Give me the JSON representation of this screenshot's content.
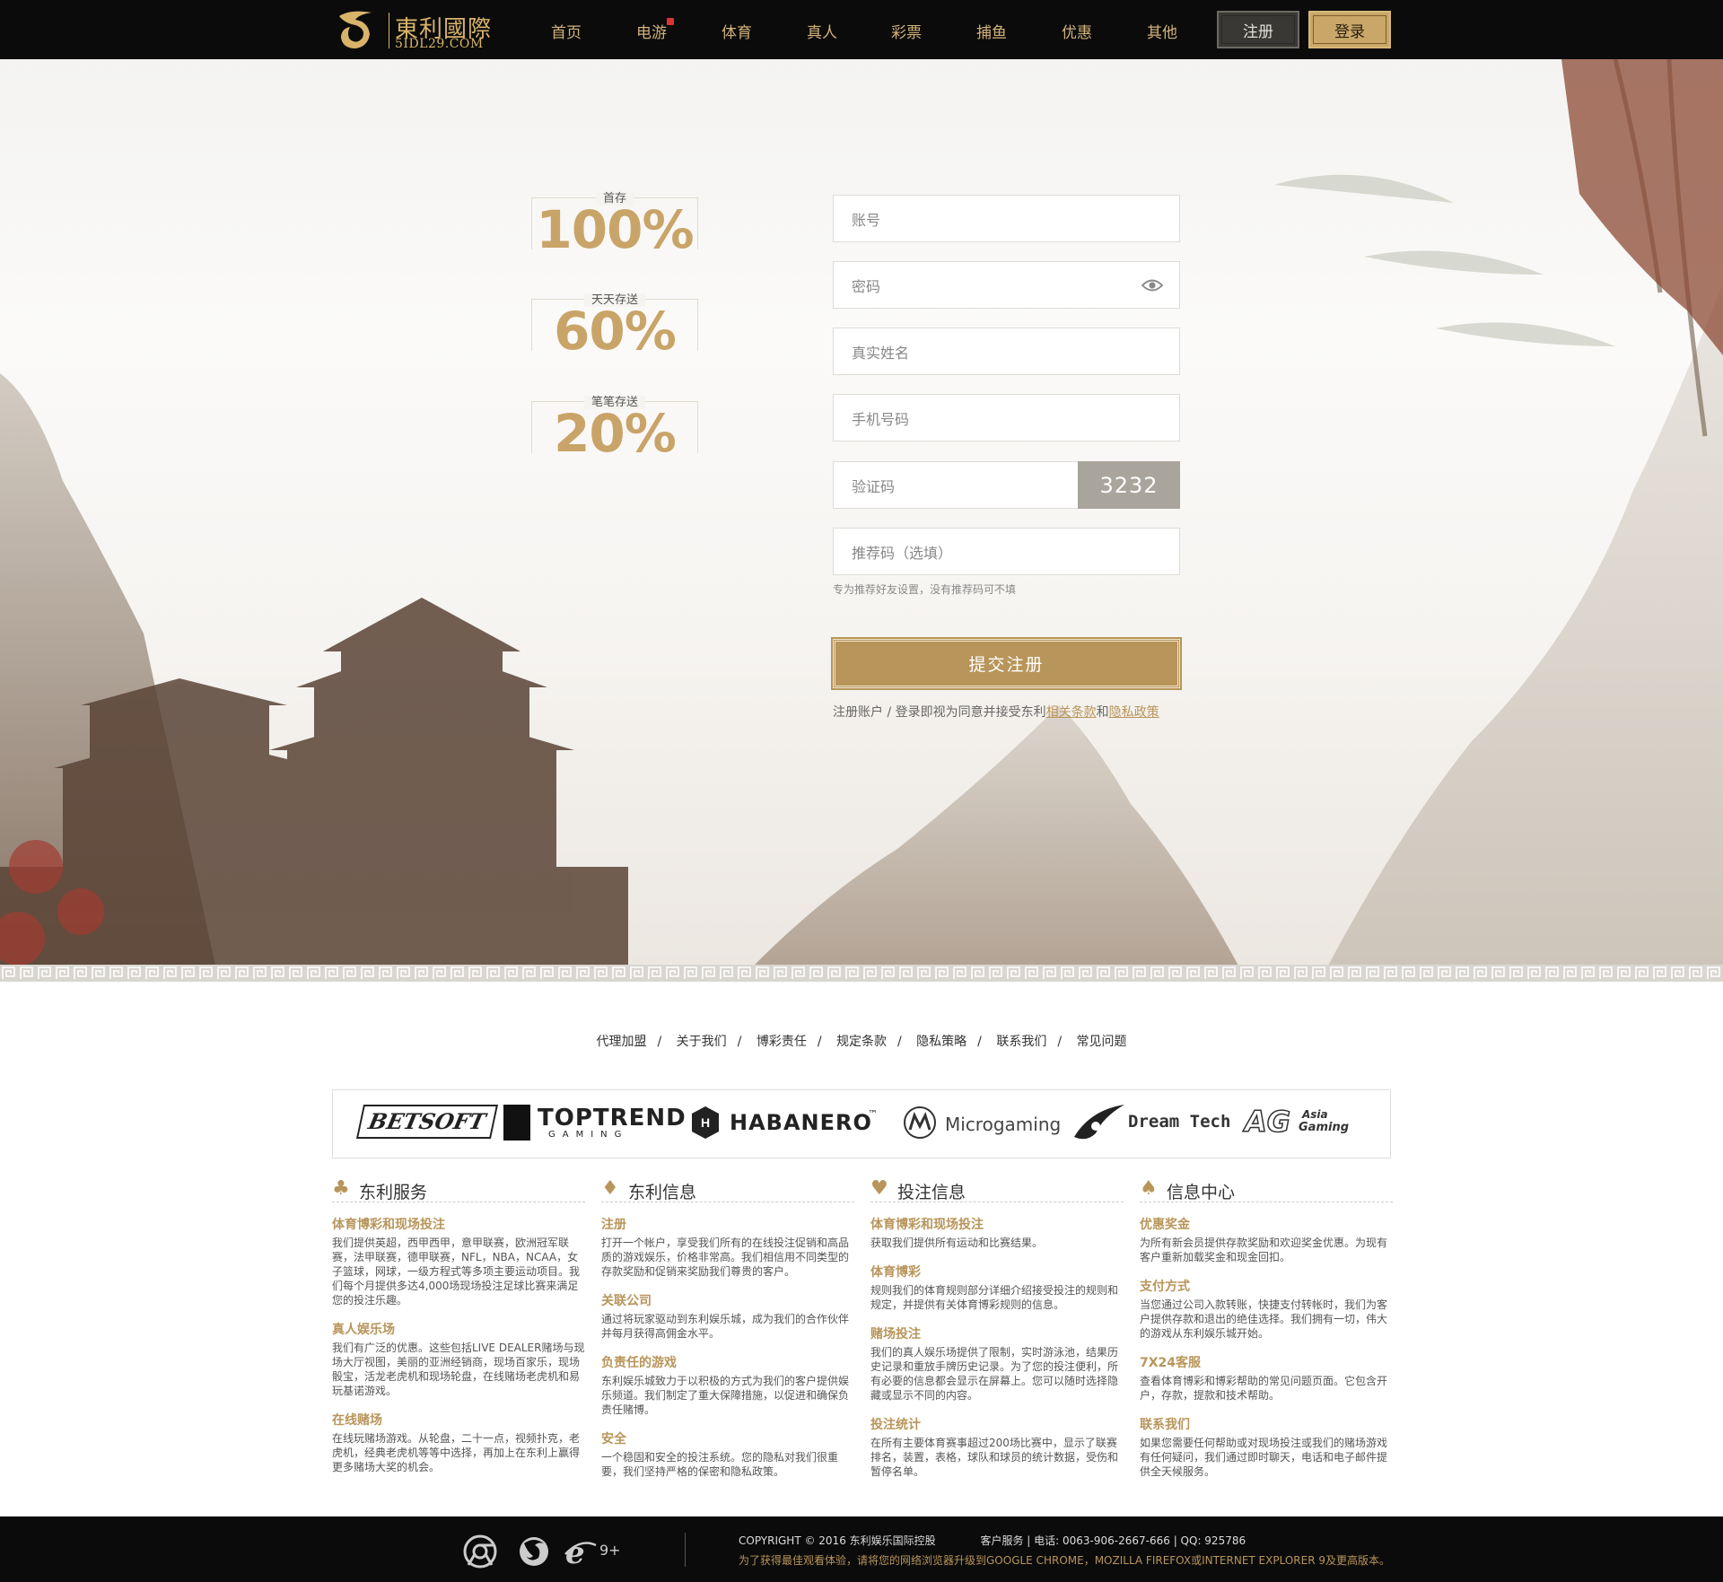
{
  "header": {
    "logo_cn": "東利國際",
    "logo_domain": "5IDL29.COM",
    "nav": [
      "首页",
      "电游",
      "体育",
      "真人",
      "彩票",
      "捕鱼",
      "优惠",
      "其他"
    ],
    "register_label": "注册",
    "login_label": "登录"
  },
  "promos": [
    {
      "label": "首存",
      "value": "100%"
    },
    {
      "label": "天天存送",
      "value": "60%"
    },
    {
      "label": "笔笔存送",
      "value": "20%"
    }
  ],
  "form": {
    "account_placeholder": "账号",
    "password_placeholder": "密码",
    "realname_placeholder": "真实姓名",
    "phone_placeholder": "手机号码",
    "captcha_placeholder": "验证码",
    "captcha_code": "3232",
    "referral_placeholder": "推荐码（选填）",
    "referral_hint": "专为推荐好友设置，没有推荐码可不填",
    "submit_label": "提交注册",
    "terms_prefix": "注册账户 / 登录即视为同意并接受东利",
    "terms_link": "相关条款",
    "terms_and": "和",
    "privacy_link": "隐私政策"
  },
  "footer_links": [
    "代理加盟",
    "关于我们",
    "博彩责任",
    "规定条款",
    "隐私策略",
    "联系我们",
    "常见问题"
  ],
  "footer_link_separator": "/",
  "providers": [
    "BETSOFT",
    "TOPTREND",
    "GAMING",
    "HABANERO",
    "™",
    "Microgaming",
    "Dream Tech",
    "Asia",
    "Gaming"
  ],
  "columns": [
    {
      "icon": "♣",
      "title": "东利服务",
      "sections": [
        {
          "title": "体育博彩和现场投注",
          "body": "我们提供英超，西甲西甲，意甲联赛，欧洲冠军联赛，法甲联赛，德甲联赛，NFL，NBA，NCAA，女子篮球，网球，一级方程式等多项主要运动项目。我们每个月提供多达4,000场现场投注足球比赛来满足您的投注乐趣。"
        },
        {
          "title": "真人娱乐场",
          "body": "我们有广泛的优惠。这些包括LIVE DEALER赌场与现场大厅视图，美丽的亚洲经销商，现场百家乐，现场骰宝，活龙老虎机和现场轮盘，在线赌场老虎机和易玩基诺游戏。"
        },
        {
          "title": "在线赌场",
          "body": "在线玩赌场游戏。从轮盘，二十一点，视频扑克，老虎机，经典老虎机等等中选择，再加上在东利上赢得更多赌场大奖的机会。"
        }
      ]
    },
    {
      "icon": "♦",
      "title": "东利信息",
      "sections": [
        {
          "title": "注册",
          "body": "打开一个帐户，享受我们所有的在线投注促销和高品质的游戏娱乐，价格非常高。我们相信用不同类型的存款奖励和促销来奖励我们尊贵的客户。"
        },
        {
          "title": "关联公司",
          "body": "通过将玩家驱动到东利娱乐城，成为我们的合作伙伴并每月获得高佣金水平。"
        },
        {
          "title": "负责任的游戏",
          "body": "东利娱乐城致力于以积极的方式为我们的客户提供娱乐频道。我们制定了重大保障措施，以促进和确保负责任赌博。"
        },
        {
          "title": "安全",
          "body": "一个稳固和安全的投注系统。您的隐私对我们很重要，我们坚持严格的保密和隐私政策。"
        }
      ]
    },
    {
      "icon": "♥",
      "title": "投注信息",
      "sections": [
        {
          "title": "体育博彩和现场投注",
          "body": "获取我们提供所有运动和比赛结果。"
        },
        {
          "title": "体育博彩",
          "body": "规则我们的体育规则部分详细介绍接受投注的规则和规定，并提供有关体育博彩规则的信息。"
        },
        {
          "title": "赌场投注",
          "body": "我们的真人娱乐场提供了限制，实时游泳池，结果历史记录和重放手牌历史记录。为了您的投注便利，所有必要的信息都会显示在屏幕上。您可以随时选择隐藏或显示不同的内容。"
        },
        {
          "title": "投注统计",
          "body": "在所有主要体育赛事超过200场比赛中，显示了联赛排名，装置，表格，球队和球员的统计数据，受伤和暂停名单。"
        }
      ]
    },
    {
      "icon": "♠",
      "title": "信息中心",
      "sections": [
        {
          "title": "优惠奖金",
          "body": "为所有新会员提供存款奖励和欢迎奖金优惠。为现有客户重新加载奖金和现金回扣。"
        },
        {
          "title": "支付方式",
          "body": "当您通过公司入款转账，快捷支付转帐时，我们为客户提供存款和退出的绝佳选择。我们拥有一切，伟大的游戏从东利娱乐城开始。"
        },
        {
          "title": "7X24客服",
          "body": "查看体育博彩和博彩帮助的常见问题页面。它包含开户，存款，提款和技术帮助。"
        },
        {
          "title": "联系我们",
          "body": "如果您需要任何帮助或对现场投注或我们的赌场游戏有任何疑问，我们通过即时聊天，电话和电子邮件提供全天候服务。"
        }
      ]
    }
  ],
  "bottom": {
    "ie_version": "9+",
    "copyright": "COPYRIGHT © 2016 东利娱乐国际控股",
    "service": "客户服务 | 电话: 0063-906-2667-666 | QQ: 925786",
    "upgrade": "为了获得最佳观看体验，请将您的网络浏览器升级到GOOGLE CHROME，MOZILLA FIREFOX或INTERNET EXPLORER 9及更高版本。"
  },
  "colors": {
    "gold": "#b8955a",
    "dark": "#0b0b0b",
    "nav_text": "#d2b27a"
  }
}
